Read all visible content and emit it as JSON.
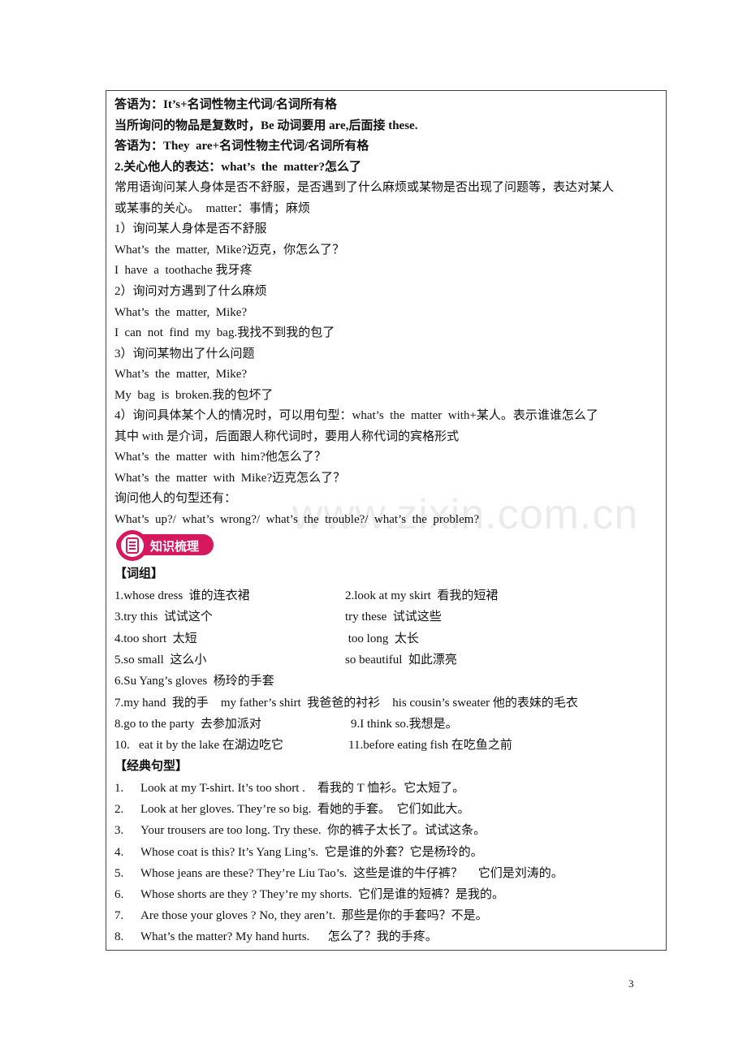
{
  "lines": [
    {
      "text": "答语为：It’s+名词性物主代词/名词所有格",
      "bold": true
    },
    {
      "text": "当所询问的物品是复数时，Be 动词要用 are,后面接 these.",
      "bold": true
    },
    {
      "text": "答语为：They  are+名词性物主代词/名词所有格",
      "bold": true
    },
    {
      "text": "2.关心他人的表达：what’s  the  matter?怎么了",
      "bold": true
    },
    {
      "text": "常用语询问某人身体是否不舒服，是否遇到了什么麻烦或某物是否出现了问题等，表达对某人",
      "bold": false
    },
    {
      "text": "或某事的关心。  matter：事情；麻烦",
      "bold": false
    },
    {
      "text": "1）询问某人身体是否不舒服",
      "bold": false
    },
    {
      "text": "What’s  the  matter,  Mike?迈克，你怎么了？",
      "bold": false
    },
    {
      "text": "I  have  a  toothache 我牙疼",
      "bold": false
    },
    {
      "text": "2）询问对方遇到了什么麻烦",
      "bold": false
    },
    {
      "text": "What’s  the  matter,  Mike?",
      "bold": false
    },
    {
      "text": "I  can  not  find  my  bag.我找不到我的包了",
      "bold": false
    },
    {
      "text": "3）询问某物出了什么问题",
      "bold": false
    },
    {
      "text": "What’s  the  matter,  Mike?",
      "bold": false
    },
    {
      "text": "My  bag  is  broken.我的包坏了",
      "bold": false
    },
    {
      "text": "4）询问具体某个人的情况时，可以用句型：what’s  the  matter  with+某人。表示谁谁怎么了",
      "bold": false
    },
    {
      "text": "其中 with 是介词，后面跟人称代词时，要用人称代词的宾格形式",
      "bold": false
    },
    {
      "text": "What’s  the  matter  with  him?他怎么了？",
      "bold": false
    },
    {
      "text": "What’s  the  matter  with  Mike?迈克怎么了？",
      "bold": false
    },
    {
      "text": "询问他人的句型还有：",
      "bold": false
    },
    {
      "text": "What’s  up?/  what’s  wrong?/  what’s  the  trouble?/  what’s  the  problem?",
      "bold": false
    }
  ],
  "badge": {
    "label": "知识梳理",
    "color": "#d6185f",
    "icon": "checklist-icon"
  },
  "phrases": {
    "heading": "【词组】",
    "rows": [
      {
        "left": "1.whose dress  谁的连衣裙",
        "right": "2.look at my skirt  看我的短裙",
        "rx": 294
      },
      {
        "left": "3.try this  试试这个",
        "right": "try these  试试这些",
        "rx": 294
      },
      {
        "left": "4.too short  太短",
        "right": " too long  太长",
        "rx": 294
      },
      {
        "left": "5.so small  这么小",
        "right": "so beautiful  如此漂亮",
        "rx": 294
      },
      {
        "left": "6.Su Yang’s gloves  杨玲的手套",
        "right": ""
      },
      {
        "left": "7.my hand  我的手    my father’s shirt  我爸爸的衬衫    his cousin’s sweater 他的表妹的毛衣",
        "right": ""
      },
      {
        "left": "8.go to the party  去参加派对",
        "right": "9.I think so.我想是。",
        "rx": 301
      },
      {
        "left": "10.   eat it by the lake 在湖边吃它",
        "right": "11.before eating fish 在吃鱼之前",
        "rx": 298
      }
    ]
  },
  "sentences": {
    "heading": "【经典句型】",
    "items": [
      {
        "num": "1.",
        "text": "Look at my T-shirt. It’s too short .    看我的 T 恤衫。它太短了。"
      },
      {
        "num": "2.",
        "text": "Look at her gloves. They’re so big.  看她的手套。  它们如此大。"
      },
      {
        "num": "3.",
        "text": "Your trousers are too long. Try these.  你的裤子太长了。试试这条。"
      },
      {
        "num": "4.",
        "text": "Whose coat is this? It’s Yang Ling’s.  它是谁的外套？它是杨玲的。"
      },
      {
        "num": "5.",
        "text": "Whose jeans are these? They’re Liu Tao’s.  这些是谁的牛仔裤？     它们是刘涛的。"
      },
      {
        "num": "6.",
        "text": "Whose shorts are they ? They’re my shorts.  它们是谁的短裤？是我的。"
      },
      {
        "num": "7.",
        "text": "Are those your gloves ? No, they aren’t.  那些是你的手套吗？不是。"
      },
      {
        "num": "8.",
        "text": "What’s the matter? My hand hurts.      怎么了？我的手疼。"
      }
    ]
  },
  "watermark": "www.zixin.com.cn",
  "page_number": "3"
}
